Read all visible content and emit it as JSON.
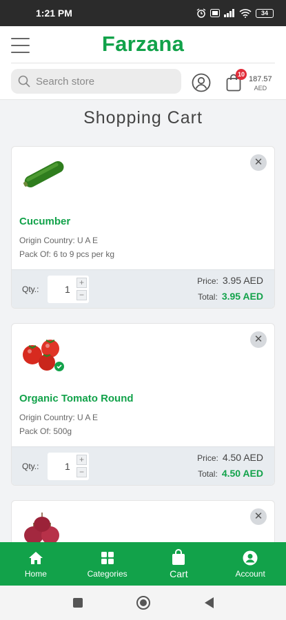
{
  "status_bar": {
    "time": "1:21 PM",
    "battery": "34"
  },
  "header": {
    "logo": "Farzana",
    "search_placeholder": "Search store",
    "cart_badge": "10",
    "cart_amount": "187.57",
    "cart_currency": "AED"
  },
  "page": {
    "title": "Shopping Cart"
  },
  "labels": {
    "qty": "Qty.:",
    "price": "Price:",
    "total": "Total:",
    "plus": "+",
    "minus": "−",
    "remove": "✕"
  },
  "cart_items": [
    {
      "name": "Cucumber",
      "origin": "Origin Country: U A E",
      "pack": "Pack Of: 6 to 9 pcs per kg",
      "qty": "1",
      "price": "3.95 AED",
      "total": "3.95 AED",
      "image": "cucumber-image"
    },
    {
      "name": "Organic Tomato Round",
      "origin": "Origin Country: U A E",
      "pack": "Pack Of: 500g",
      "qty": "1",
      "price": "4.50 AED",
      "total": "4.50 AED",
      "image": "tomato-image"
    },
    {
      "image": "onion-image"
    }
  ],
  "bottom_nav": [
    {
      "label": "Home",
      "icon": "home-icon"
    },
    {
      "label": "Categories",
      "icon": "grid-icon"
    },
    {
      "label": "Cart",
      "icon": "bag-icon",
      "active": true
    },
    {
      "label": "Account",
      "icon": "account-icon"
    }
  ],
  "colors": {
    "brand": "#12a24a",
    "badge": "#e12d3a"
  }
}
